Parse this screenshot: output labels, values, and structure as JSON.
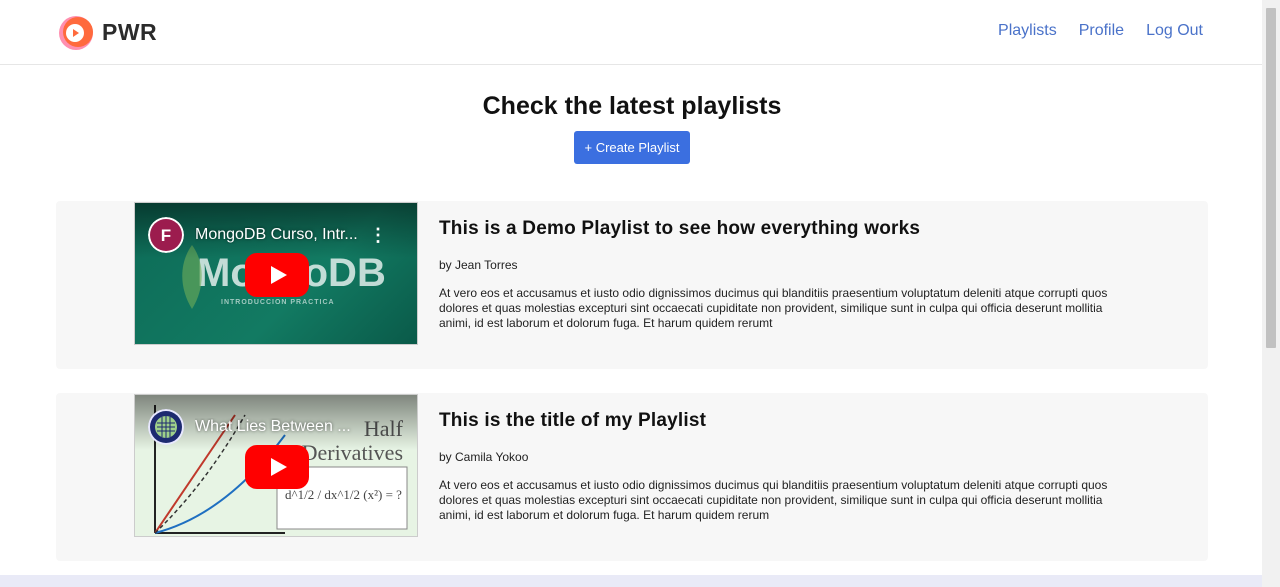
{
  "brand": {
    "name": "PWR"
  },
  "nav": {
    "links": [
      "Playlists",
      "Profile",
      "Log Out"
    ]
  },
  "main": {
    "title": "Check the latest playlists",
    "create_button": "+ Create Playlist"
  },
  "playlists": [
    {
      "video_title": "MongoDB Curso, Intr...",
      "thumb_text": "MongoDB",
      "thumb_subtext": "INTRODUCCION PRACTICA",
      "title": "This is a Demo Playlist to see how everything works",
      "author": "by Jean Torres",
      "description": "At vero eos et accusamus et iusto odio dignissimos ducimus qui blanditiis praesentium voluptatum deleniti atque corrupti quos dolores et quas molestias excepturi sint occaecati cupiditate non provident, similique sunt in culpa qui officia deserunt mollitia animi, id est laborum et dolorum fuga. Et harum quidem rerumt"
    },
    {
      "video_title": "What Lies Between ...",
      "thumb_text": "Half Derivatives",
      "thumb_formula": "d^1/2 / dx^1/2 (x²) = ?",
      "title": "This is the title of my Playlist",
      "author": "by Camila Yokoo",
      "description": "At vero eos et accusamus et iusto odio dignissimos ducimus qui blanditiis praesentium voluptatum deleniti atque corrupti quos dolores et quas molestias excepturi sint occaecati cupiditate non provident, similique sunt in culpa qui officia deserunt mollitia animi, id est laborum et dolorum fuga. Et harum quidem rerum"
    }
  ],
  "colors": {
    "link": "#4a72c9",
    "button": "#3b6fe0",
    "card_bg": "#f7f7f7",
    "youtube_red": "#ff0000"
  }
}
